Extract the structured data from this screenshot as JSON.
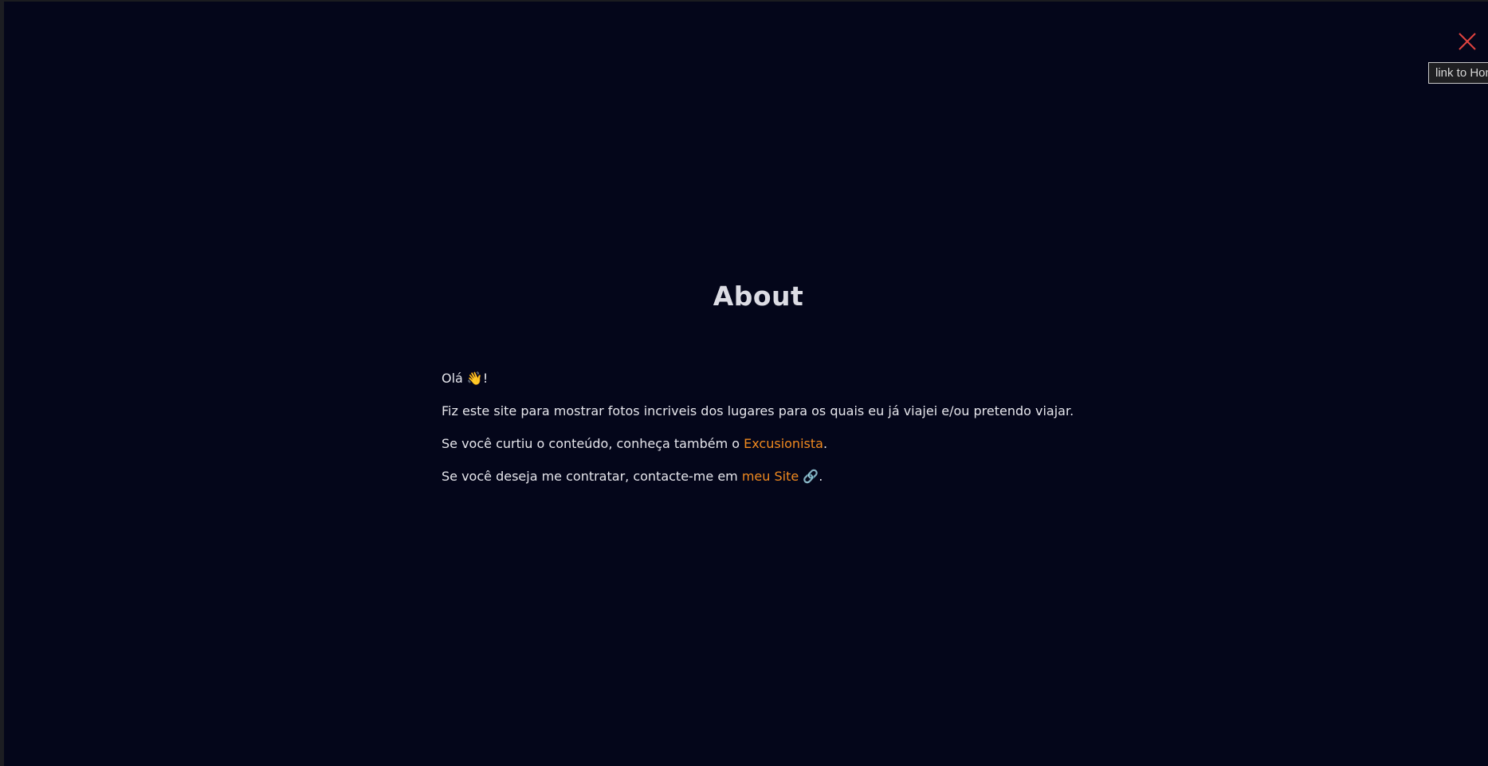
{
  "colors": {
    "background": "#04061a",
    "accent": "#f0891f",
    "close": "#e0433f"
  },
  "close": {
    "icon": "close-icon"
  },
  "tooltip": {
    "text": "link to Home"
  },
  "about": {
    "title": "About",
    "greeting": "Olá 👋!",
    "intro": "Fiz este site para mostrar fotos incriveis dos lugares para os quais eu já viajei e/ou pretendo viajar.",
    "line3_prefix": "Se você curtiu o conteúdo, conheça também o ",
    "line3_link": "Excusionista",
    "line3_suffix": ".",
    "line4_prefix": "Se você deseja me contratar, contacte-me em ",
    "line4_link": "meu Site",
    "line4_icon": "🔗",
    "line4_suffix": "."
  }
}
